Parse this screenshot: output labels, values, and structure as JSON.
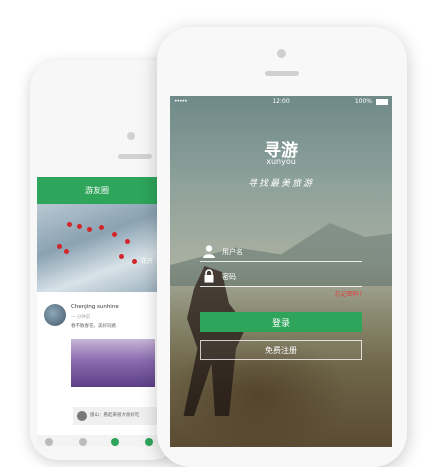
{
  "back_screen": {
    "header_title": "游友圈",
    "banner_tag": "花开",
    "post": {
      "author": "Chenjing sunhine",
      "time": "一 分钟前",
      "text": "春不散春花，美好同路",
      "comment": "傲山：看起来很大很好吃"
    }
  },
  "front_screen": {
    "status": {
      "carrier": "•••••",
      "time": "12:00",
      "battery": "100%"
    },
    "logo_cn": "寻游",
    "logo_en": "xunyou",
    "slogan": "寻找最美旅游",
    "username_placeholder": "用户名",
    "password_placeholder": "密码",
    "forgot_label": "忘记密码?",
    "login_label": "登录",
    "register_label": "免费注册",
    "accent_color": "#2ea55b"
  }
}
